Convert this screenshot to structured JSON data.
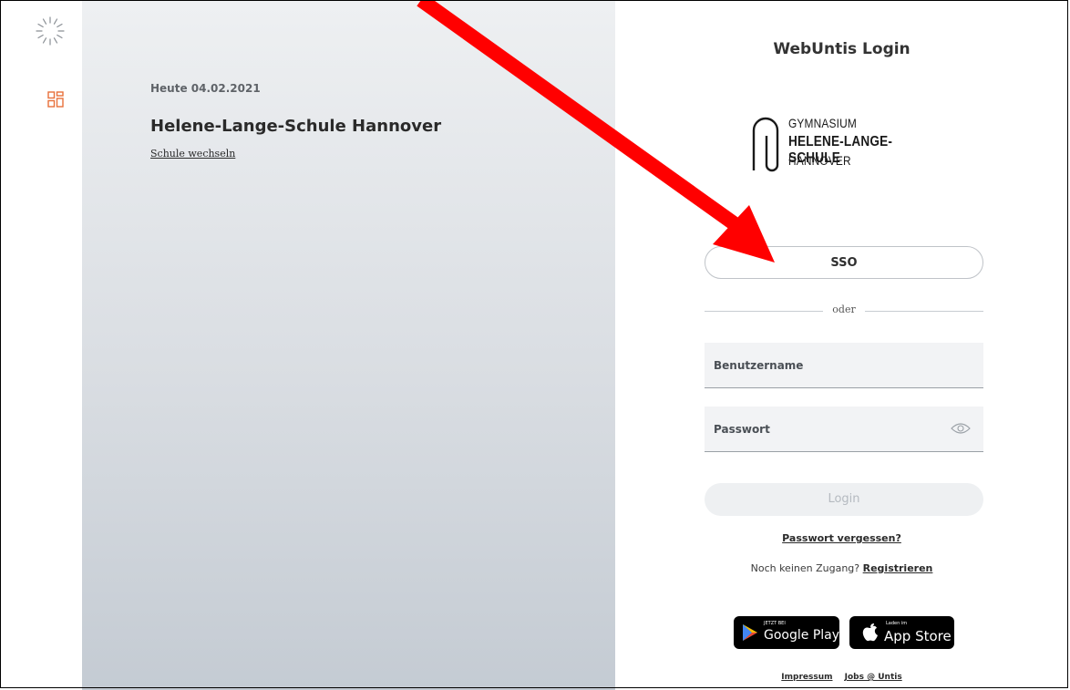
{
  "sidebar": {
    "loading_icon": "spinner-icon",
    "apps_icon": "grid-icon",
    "accent_color": "#e8703a"
  },
  "school_panel": {
    "date": "Heute 04.02.2021",
    "school_name": "Helene-Lange-Schule Hannover",
    "change_school": "Schule wechseln"
  },
  "login": {
    "title": "WebUntis Login",
    "logo": {
      "line1": "GYMNASIUM",
      "line2": "HELENE-LANGE-SCHULE",
      "line3": "HANNOVER"
    },
    "sso_label": "SSO",
    "divider_label": "oder",
    "username_placeholder": "Benutzername",
    "password_placeholder": "Passwort",
    "login_label": "Login",
    "forgot_password": "Passwort vergessen?",
    "no_access_text": "Noch keinen Zugang?",
    "register_label": "Registrieren",
    "google_play_small": "JETZT BEI",
    "google_play_big": "Google Play",
    "app_store_small": "Laden im",
    "app_store_big": "App Store",
    "imprint": "Impressum",
    "jobs": "Jobs @ Untis"
  },
  "annotation": {
    "arrow_color": "#ff0000"
  }
}
